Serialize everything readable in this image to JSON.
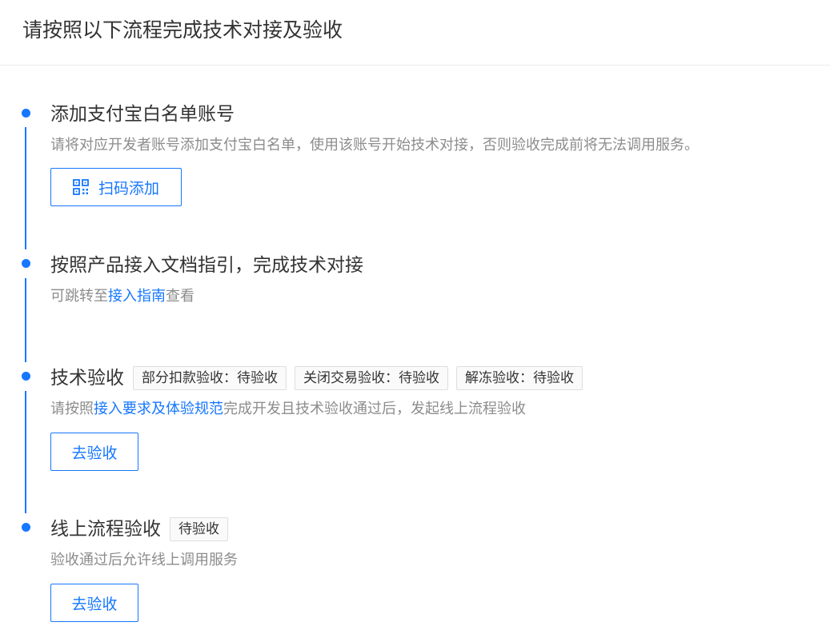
{
  "header": {
    "title": "请按照以下流程完成技术对接及验收"
  },
  "steps": [
    {
      "title": "添加支付宝白名单账号",
      "desc": "请将对应开发者账号添加支付宝白名单，使用该账号开始技术对接，否则验收完成前将无法调用服务。",
      "button_label": "扫码添加",
      "button_icon": "qrcode-icon"
    },
    {
      "title": "按照产品接入文档指引，完成技术对接",
      "desc_prefix": "可跳转至",
      "desc_link": "接入指南",
      "desc_suffix": "查看"
    },
    {
      "title": "技术验收",
      "tags": [
        "部分扣款验收：待验收",
        "关闭交易验收：待验收",
        "解冻验收：待验收"
      ],
      "desc_prefix": "请按照",
      "desc_link": "接入要求及体验规范",
      "desc_suffix": "完成开发且技术验收通过后，发起线上流程验收",
      "button_label": "去验收"
    },
    {
      "title": "线上流程验收",
      "tags": [
        "待验收"
      ],
      "desc": "验收通过后允许线上调用服务",
      "button_label": "去验收"
    }
  ],
  "colors": {
    "accent": "#1677ff",
    "text": "#333333",
    "muted": "#8c8c8c",
    "tag_border": "#dedede",
    "tag_bg": "#fafafa"
  }
}
